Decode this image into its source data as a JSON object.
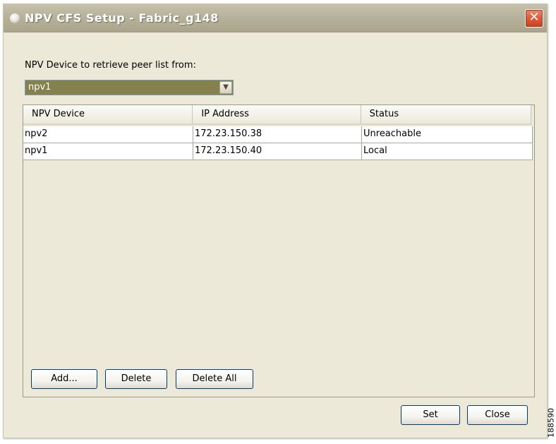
{
  "window": {
    "title": "NPV CFS Setup - Fabric_g148",
    "close_glyph": "✕"
  },
  "retrieve": {
    "label": "NPV Device to retrieve peer list from:",
    "selected": "npv1",
    "arrow_glyph": "▼"
  },
  "table": {
    "columns": [
      "NPV Device",
      "IP Address",
      "Status"
    ],
    "rows": [
      [
        "npv2",
        "172.23.150.38",
        "Unreachable"
      ],
      [
        "npv1",
        "172.23.150.40",
        "Local"
      ]
    ]
  },
  "buttons": {
    "add": "Add...",
    "delete": "Delete",
    "delete_all": "Delete All",
    "set": "Set",
    "close": "Close"
  },
  "figure_id": "188590",
  "colors": {
    "title_bar": "#b7b29b",
    "window_bg": "#ece9d8",
    "combo_selected_bg": "#85814e",
    "close_button": "#e1593a"
  }
}
